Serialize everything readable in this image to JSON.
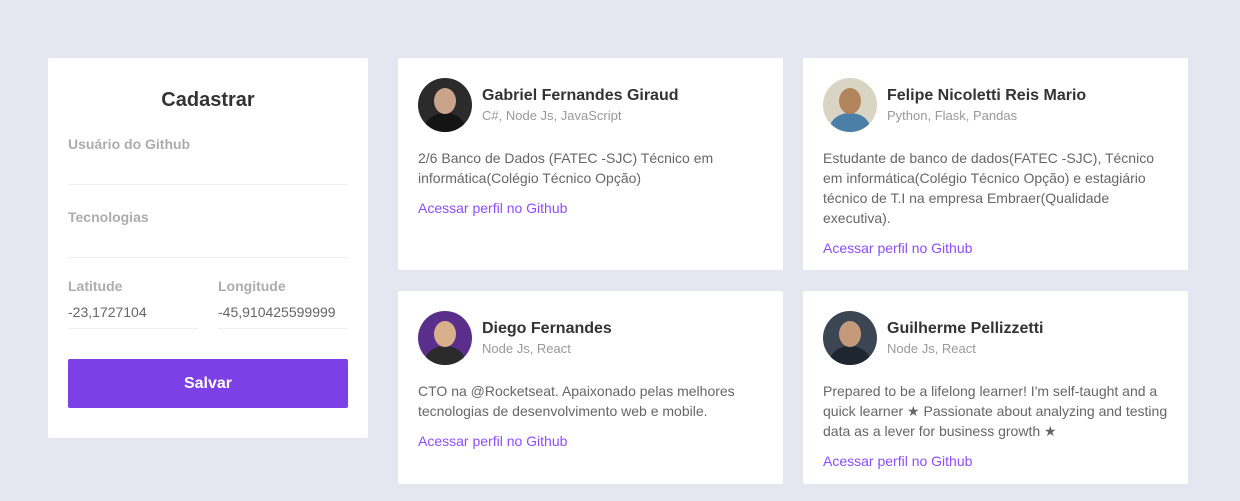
{
  "form": {
    "title": "Cadastrar",
    "github_user_label": "Usuário do Github",
    "github_user_value": "",
    "techs_label": "Tecnologias",
    "techs_value": "",
    "latitude_label": "Latitude",
    "latitude_value": "-23,1727104",
    "longitude_label": "Longitude",
    "longitude_value": "-45,910425599999",
    "save_label": "Salvar"
  },
  "devs": [
    {
      "name": "Gabriel Fernandes Giraud",
      "techs": "C#, Node Js, JavaScript",
      "bio": "2/6 Banco de Dados (FATEC -SJC) Técnico em informática(Colégio Técnico Opção)",
      "link": "Acessar perfil no Github"
    },
    {
      "name": "Felipe Nicoletti Reis Mario",
      "techs": "Python, Flask, Pandas",
      "bio": "Estudante de banco de dados(FATEC -SJC), Técnico em informática(Colégio Técnico Opção) e estagiário técnico de T.I na empresa Embraer(Qualidade executiva).",
      "link": "Acessar perfil no Github"
    },
    {
      "name": "Diego Fernandes",
      "techs": "Node Js, React",
      "bio": "CTO na @Rocketseat. Apaixonado pelas melhores tecnologias de desenvolvimento web e mobile.",
      "link": "Acessar perfil no Github"
    },
    {
      "name": "Guilherme Pellizzetti",
      "techs": "Node Js, React",
      "bio": "Prepared to be a lifelong learner! I'm self-taught and a quick learner ★ Passionate about analyzing and testing data as a lever for business growth ★",
      "link": "Acessar perfil no Github"
    }
  ],
  "colors": {
    "background": "#e6e6f0",
    "accent": "#7d40e7",
    "link": "#8e4dff"
  }
}
